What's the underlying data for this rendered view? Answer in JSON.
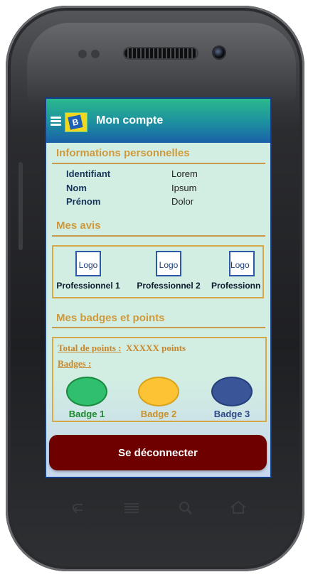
{
  "app": {
    "title": "Mon compte",
    "logo_letter": "B"
  },
  "personal": {
    "title": "Informations personnelles",
    "rows": [
      {
        "key": "Identifiant",
        "value": "Lorem"
      },
      {
        "key": "Nom",
        "value": "Ipsum"
      },
      {
        "key": "Prénom",
        "value": "Dolor"
      }
    ]
  },
  "reviews": {
    "title": "Mes avis",
    "items": [
      {
        "logo": "Logo",
        "label": "Professionnel 1"
      },
      {
        "logo": "Logo",
        "label": "Professionnel 2"
      },
      {
        "logo": "Logo",
        "label": "Professionn"
      }
    ]
  },
  "badges": {
    "title": "Mes badges et points",
    "points_label": "Total de points :",
    "points_value": "XXXXX points",
    "badges_label": "Badges :",
    "items": [
      {
        "label": "Badge 1",
        "fill": "#2fbf6e",
        "border": "#1a8a3e",
        "text_color": "#1b8a2c"
      },
      {
        "label": "Badge 2",
        "fill": "#fcc434",
        "border": "#d9a21c",
        "text_color": "#c9902a"
      },
      {
        "label": "Badge 3",
        "fill": "#3b5698",
        "border": "#243f7c",
        "text_color": "#2e4a88"
      }
    ]
  },
  "logout_label": "Se déconnecter",
  "colors": {
    "accent": "#d09a3c",
    "logout": "#6f0000",
    "screen_bg": "#d2eee2"
  },
  "nav_icons": [
    "back-icon",
    "menu-icon",
    "search-icon",
    "home-icon"
  ]
}
